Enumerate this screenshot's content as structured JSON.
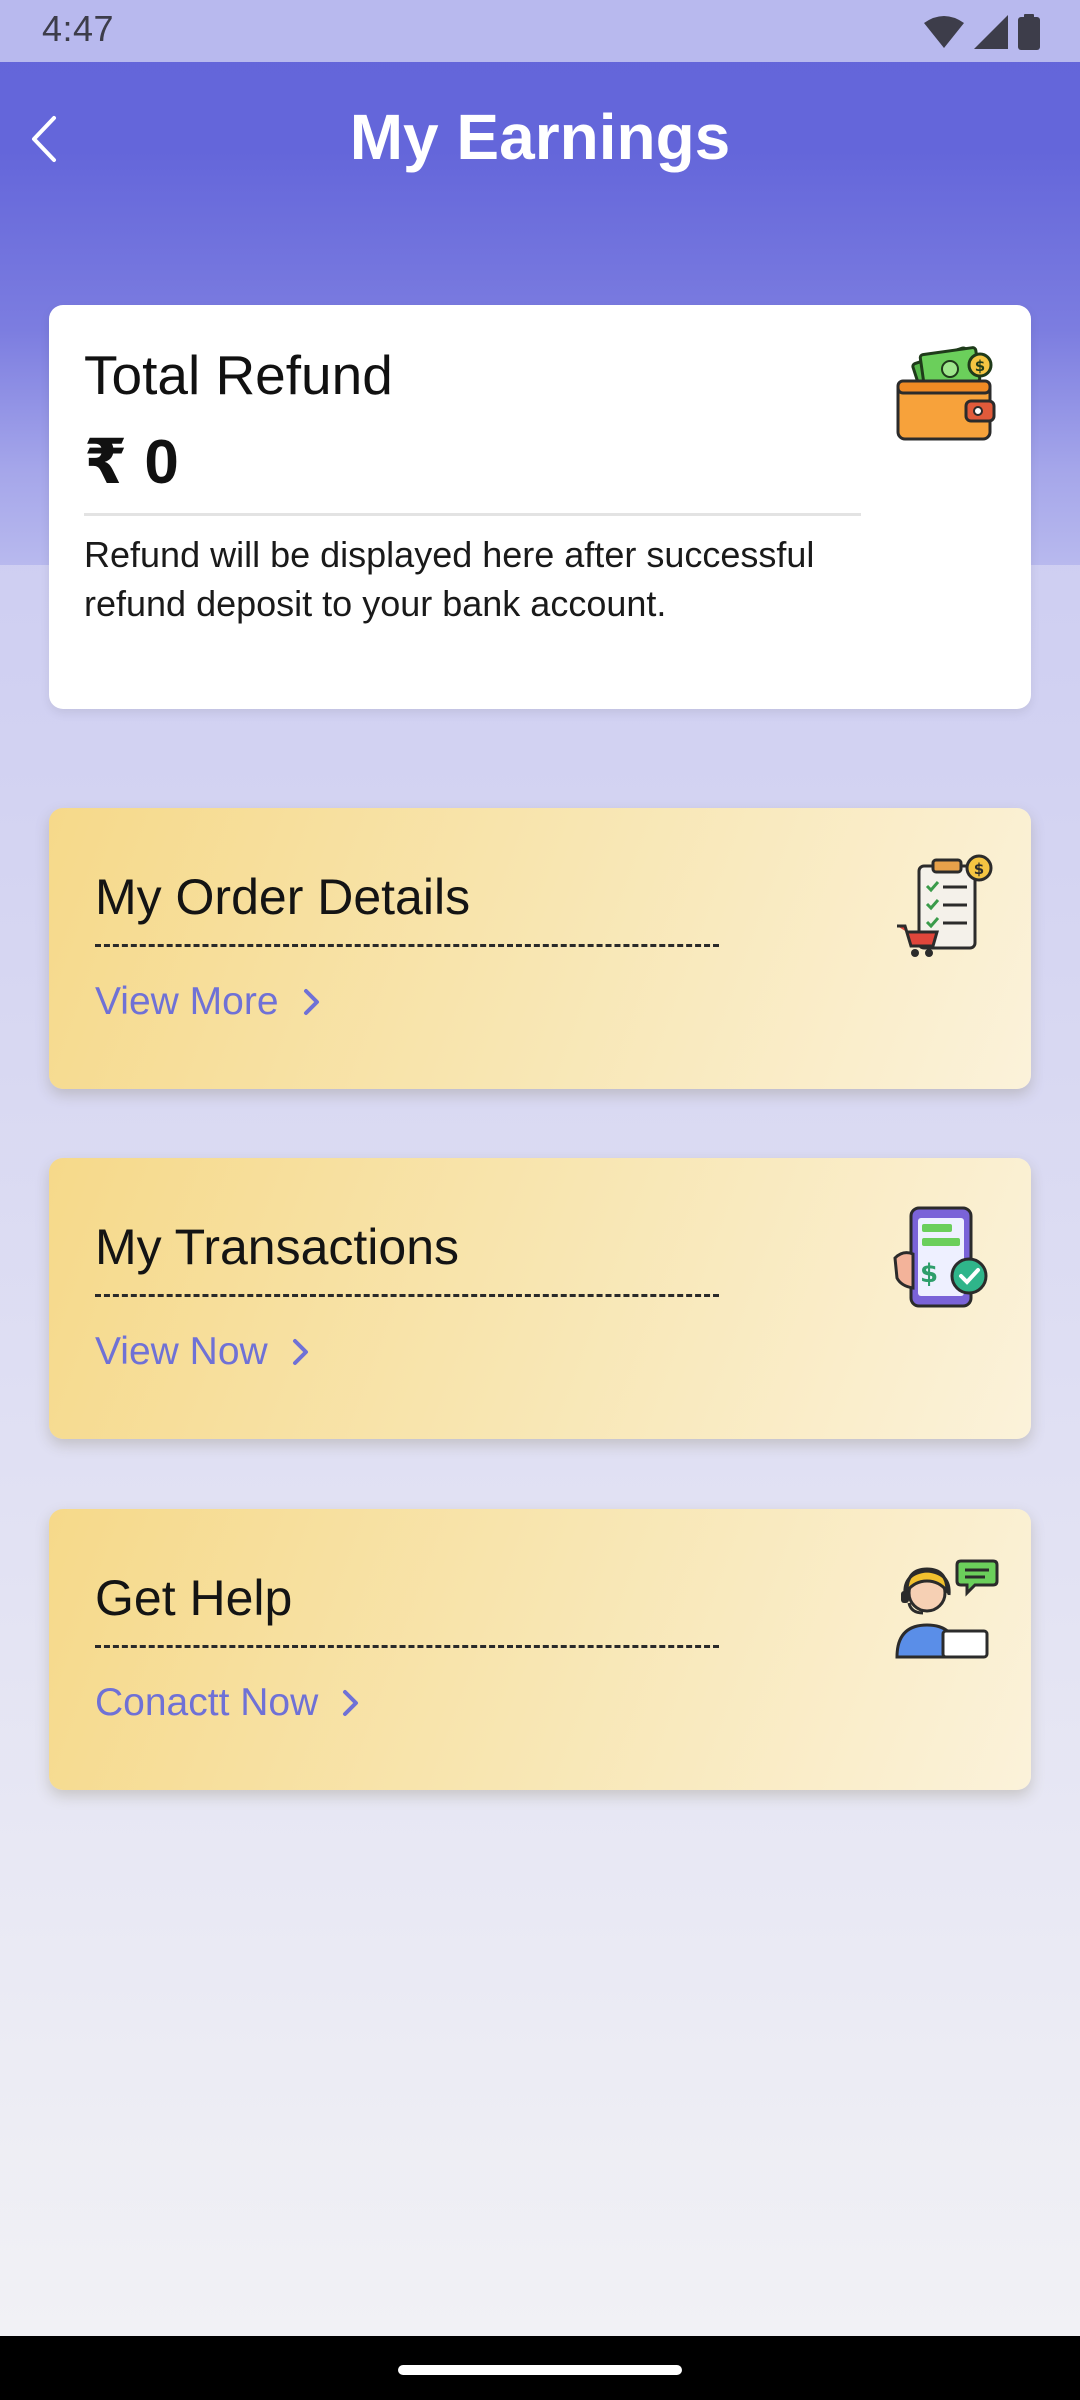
{
  "status_bar": {
    "time": "4:47",
    "icons": [
      "wifi-icon",
      "signal-icon",
      "battery-icon"
    ]
  },
  "header": {
    "title": "My Earnings",
    "back_icon": "chevron-left-icon"
  },
  "refund_card": {
    "title": "Total Refund",
    "amount": "₹ 0",
    "note": "Refund will be displayed here after successful refund deposit to your bank account.",
    "icon": "wallet-icon"
  },
  "cards": [
    {
      "title": "My Order Details",
      "link": "View More",
      "icon": "order-clipboard-icon"
    },
    {
      "title": "My Transactions",
      "link": "View Now",
      "icon": "mobile-payment-icon"
    },
    {
      "title": "Get Help",
      "link": "Conactt Now",
      "icon": "support-agent-icon"
    }
  ],
  "colors": {
    "header": "#6465d9",
    "link": "#6f71d6",
    "card_gold": "#f6d98a"
  }
}
